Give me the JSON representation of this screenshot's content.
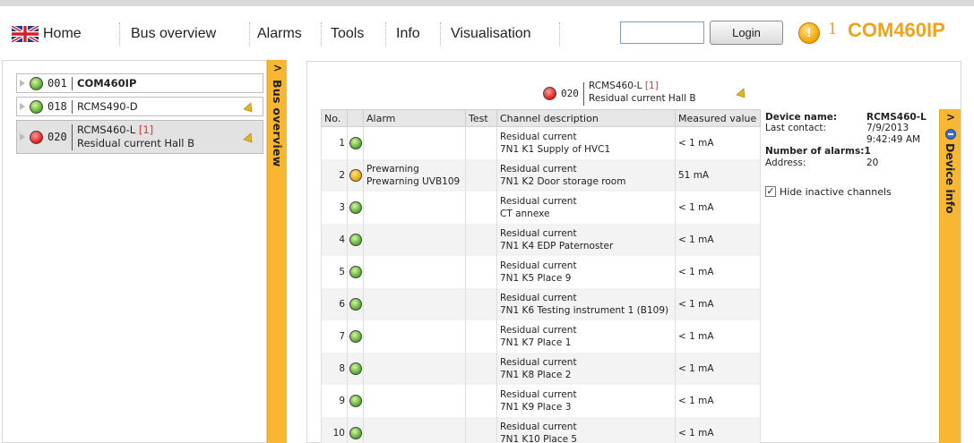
{
  "nav": {
    "flag_icon": "uk-flag-icon",
    "home": "Home",
    "bus_overview": "Bus overview",
    "alarms": "Alarms",
    "tools": "Tools",
    "info": "Info",
    "visualisation": "Visualisation",
    "login_value": "",
    "login_button": "Login",
    "alarm_count": "1",
    "device_name": "COM460IP"
  },
  "colors": {
    "accent": "#f7b733",
    "title": "#f0a31a",
    "alarm_red": "#e03030"
  },
  "bus_overview": {
    "tab_label": "Bus overview",
    "chevron": ">",
    "devices": [
      {
        "status": "green",
        "address": "001",
        "name": "COM460IP",
        "bold": true
      },
      {
        "status": "green",
        "address": "018",
        "name": "RCMS490-D",
        "bell": "bell-icon"
      },
      {
        "status": "red",
        "address": "020",
        "name": "RCMS460-L",
        "alarm_tag": "[1]",
        "subname": "Residual current Hall B",
        "bell": "bell-icon",
        "selected": true
      }
    ]
  },
  "header_device": {
    "status": "red",
    "address": "020",
    "name": "RCMS460-L",
    "alarm_tag": "[1]",
    "subname": "Residual current Hall B"
  },
  "table": {
    "columns": [
      "No.",
      "",
      "Alarm",
      "Test",
      "Channel description",
      "Measured value"
    ],
    "rows": [
      {
        "no": "1",
        "status": "green",
        "alarm": "",
        "alarm2": "",
        "test": "",
        "desc1": "Residual current",
        "desc2": "7N1 K1 Supply of HVC1",
        "value": "< 1 mA"
      },
      {
        "no": "2",
        "status": "yellow",
        "alarm": "Prewarning",
        "alarm2": "Prewarning UVB109",
        "test": "",
        "desc1": "Residual current",
        "desc2": "7N1 K2 Door storage room",
        "value": "51 mA"
      },
      {
        "no": "3",
        "status": "green",
        "alarm": "",
        "alarm2": "",
        "test": "",
        "desc1": "Residual current",
        "desc2": "CT annexe",
        "value": "< 1 mA"
      },
      {
        "no": "4",
        "status": "green",
        "alarm": "",
        "alarm2": "",
        "test": "",
        "desc1": "Residual current",
        "desc2": "7N1 K4 EDP Paternoster",
        "value": "< 1 mA"
      },
      {
        "no": "5",
        "status": "green",
        "alarm": "",
        "alarm2": "",
        "test": "",
        "desc1": "Residual current",
        "desc2": "7N1 K5 Place 9",
        "value": "< 1 mA"
      },
      {
        "no": "6",
        "status": "green",
        "alarm": "",
        "alarm2": "",
        "test": "",
        "desc1": "Residual current",
        "desc2": "7N1 K6 Testing instrument 1 (B109)",
        "value": "< 1 mA"
      },
      {
        "no": "7",
        "status": "green",
        "alarm": "",
        "alarm2": "",
        "test": "",
        "desc1": "Residual current",
        "desc2": "7N1 K7 Place 1",
        "value": "< 1 mA"
      },
      {
        "no": "8",
        "status": "green",
        "alarm": "",
        "alarm2": "",
        "test": "",
        "desc1": "Residual current",
        "desc2": "7N1 K8 Place 2",
        "value": "< 1 mA"
      },
      {
        "no": "9",
        "status": "green",
        "alarm": "",
        "alarm2": "",
        "test": "",
        "desc1": "Residual current",
        "desc2": "7N1 K9 Place 3",
        "value": "< 1 mA"
      },
      {
        "no": "10",
        "status": "green",
        "alarm": "",
        "alarm2": "",
        "test": "",
        "desc1": "Residual current",
        "desc2": "7N1 K10 Place 5",
        "value": "< 1 mA"
      }
    ]
  },
  "device_info": {
    "tab_label": "Device info",
    "chevron": ">",
    "name_label": "Device name:",
    "name_value": "RCMS460-L",
    "contact_label": "Last contact:",
    "contact_date": "7/9/2013",
    "contact_time": "9:42:49 AM",
    "alarms_label": "Number of alarms:",
    "alarms_value": "1",
    "address_label": "Address:",
    "address_value": "20",
    "hide_inactive_label": "Hide inactive channels",
    "hide_inactive_checked": true
  }
}
